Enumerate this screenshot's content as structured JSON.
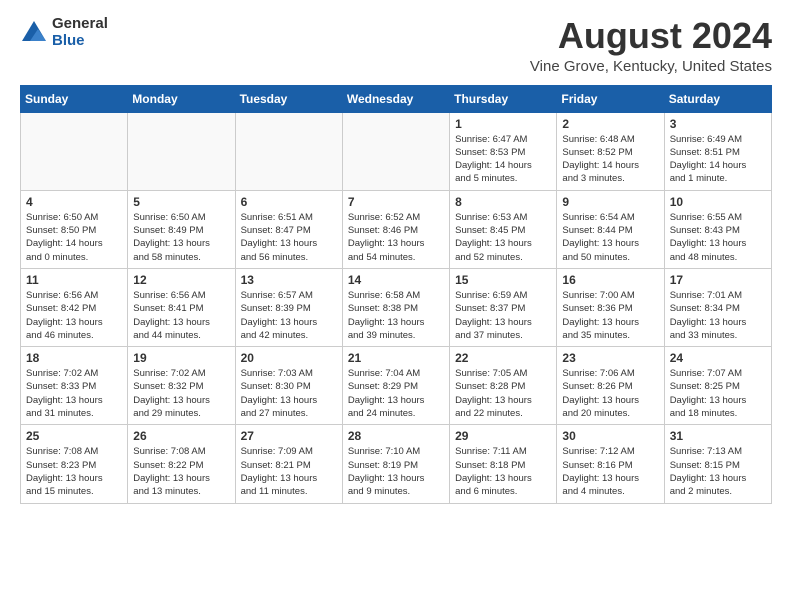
{
  "header": {
    "logo_general": "General",
    "logo_blue": "Blue",
    "month_year": "August 2024",
    "location": "Vine Grove, Kentucky, United States"
  },
  "weekdays": [
    "Sunday",
    "Monday",
    "Tuesday",
    "Wednesday",
    "Thursday",
    "Friday",
    "Saturday"
  ],
  "weeks": [
    [
      {
        "day": "",
        "detail": ""
      },
      {
        "day": "",
        "detail": ""
      },
      {
        "day": "",
        "detail": ""
      },
      {
        "day": "",
        "detail": ""
      },
      {
        "day": "1",
        "detail": "Sunrise: 6:47 AM\nSunset: 8:53 PM\nDaylight: 14 hours\nand 5 minutes."
      },
      {
        "day": "2",
        "detail": "Sunrise: 6:48 AM\nSunset: 8:52 PM\nDaylight: 14 hours\nand 3 minutes."
      },
      {
        "day": "3",
        "detail": "Sunrise: 6:49 AM\nSunset: 8:51 PM\nDaylight: 14 hours\nand 1 minute."
      }
    ],
    [
      {
        "day": "4",
        "detail": "Sunrise: 6:50 AM\nSunset: 8:50 PM\nDaylight: 14 hours\nand 0 minutes."
      },
      {
        "day": "5",
        "detail": "Sunrise: 6:50 AM\nSunset: 8:49 PM\nDaylight: 13 hours\nand 58 minutes."
      },
      {
        "day": "6",
        "detail": "Sunrise: 6:51 AM\nSunset: 8:47 PM\nDaylight: 13 hours\nand 56 minutes."
      },
      {
        "day": "7",
        "detail": "Sunrise: 6:52 AM\nSunset: 8:46 PM\nDaylight: 13 hours\nand 54 minutes."
      },
      {
        "day": "8",
        "detail": "Sunrise: 6:53 AM\nSunset: 8:45 PM\nDaylight: 13 hours\nand 52 minutes."
      },
      {
        "day": "9",
        "detail": "Sunrise: 6:54 AM\nSunset: 8:44 PM\nDaylight: 13 hours\nand 50 minutes."
      },
      {
        "day": "10",
        "detail": "Sunrise: 6:55 AM\nSunset: 8:43 PM\nDaylight: 13 hours\nand 48 minutes."
      }
    ],
    [
      {
        "day": "11",
        "detail": "Sunrise: 6:56 AM\nSunset: 8:42 PM\nDaylight: 13 hours\nand 46 minutes."
      },
      {
        "day": "12",
        "detail": "Sunrise: 6:56 AM\nSunset: 8:41 PM\nDaylight: 13 hours\nand 44 minutes."
      },
      {
        "day": "13",
        "detail": "Sunrise: 6:57 AM\nSunset: 8:39 PM\nDaylight: 13 hours\nand 42 minutes."
      },
      {
        "day": "14",
        "detail": "Sunrise: 6:58 AM\nSunset: 8:38 PM\nDaylight: 13 hours\nand 39 minutes."
      },
      {
        "day": "15",
        "detail": "Sunrise: 6:59 AM\nSunset: 8:37 PM\nDaylight: 13 hours\nand 37 minutes."
      },
      {
        "day": "16",
        "detail": "Sunrise: 7:00 AM\nSunset: 8:36 PM\nDaylight: 13 hours\nand 35 minutes."
      },
      {
        "day": "17",
        "detail": "Sunrise: 7:01 AM\nSunset: 8:34 PM\nDaylight: 13 hours\nand 33 minutes."
      }
    ],
    [
      {
        "day": "18",
        "detail": "Sunrise: 7:02 AM\nSunset: 8:33 PM\nDaylight: 13 hours\nand 31 minutes."
      },
      {
        "day": "19",
        "detail": "Sunrise: 7:02 AM\nSunset: 8:32 PM\nDaylight: 13 hours\nand 29 minutes."
      },
      {
        "day": "20",
        "detail": "Sunrise: 7:03 AM\nSunset: 8:30 PM\nDaylight: 13 hours\nand 27 minutes."
      },
      {
        "day": "21",
        "detail": "Sunrise: 7:04 AM\nSunset: 8:29 PM\nDaylight: 13 hours\nand 24 minutes."
      },
      {
        "day": "22",
        "detail": "Sunrise: 7:05 AM\nSunset: 8:28 PM\nDaylight: 13 hours\nand 22 minutes."
      },
      {
        "day": "23",
        "detail": "Sunrise: 7:06 AM\nSunset: 8:26 PM\nDaylight: 13 hours\nand 20 minutes."
      },
      {
        "day": "24",
        "detail": "Sunrise: 7:07 AM\nSunset: 8:25 PM\nDaylight: 13 hours\nand 18 minutes."
      }
    ],
    [
      {
        "day": "25",
        "detail": "Sunrise: 7:08 AM\nSunset: 8:23 PM\nDaylight: 13 hours\nand 15 minutes."
      },
      {
        "day": "26",
        "detail": "Sunrise: 7:08 AM\nSunset: 8:22 PM\nDaylight: 13 hours\nand 13 minutes."
      },
      {
        "day": "27",
        "detail": "Sunrise: 7:09 AM\nSunset: 8:21 PM\nDaylight: 13 hours\nand 11 minutes."
      },
      {
        "day": "28",
        "detail": "Sunrise: 7:10 AM\nSunset: 8:19 PM\nDaylight: 13 hours\nand 9 minutes."
      },
      {
        "day": "29",
        "detail": "Sunrise: 7:11 AM\nSunset: 8:18 PM\nDaylight: 13 hours\nand 6 minutes."
      },
      {
        "day": "30",
        "detail": "Sunrise: 7:12 AM\nSunset: 8:16 PM\nDaylight: 13 hours\nand 4 minutes."
      },
      {
        "day": "31",
        "detail": "Sunrise: 7:13 AM\nSunset: 8:15 PM\nDaylight: 13 hours\nand 2 minutes."
      }
    ]
  ]
}
